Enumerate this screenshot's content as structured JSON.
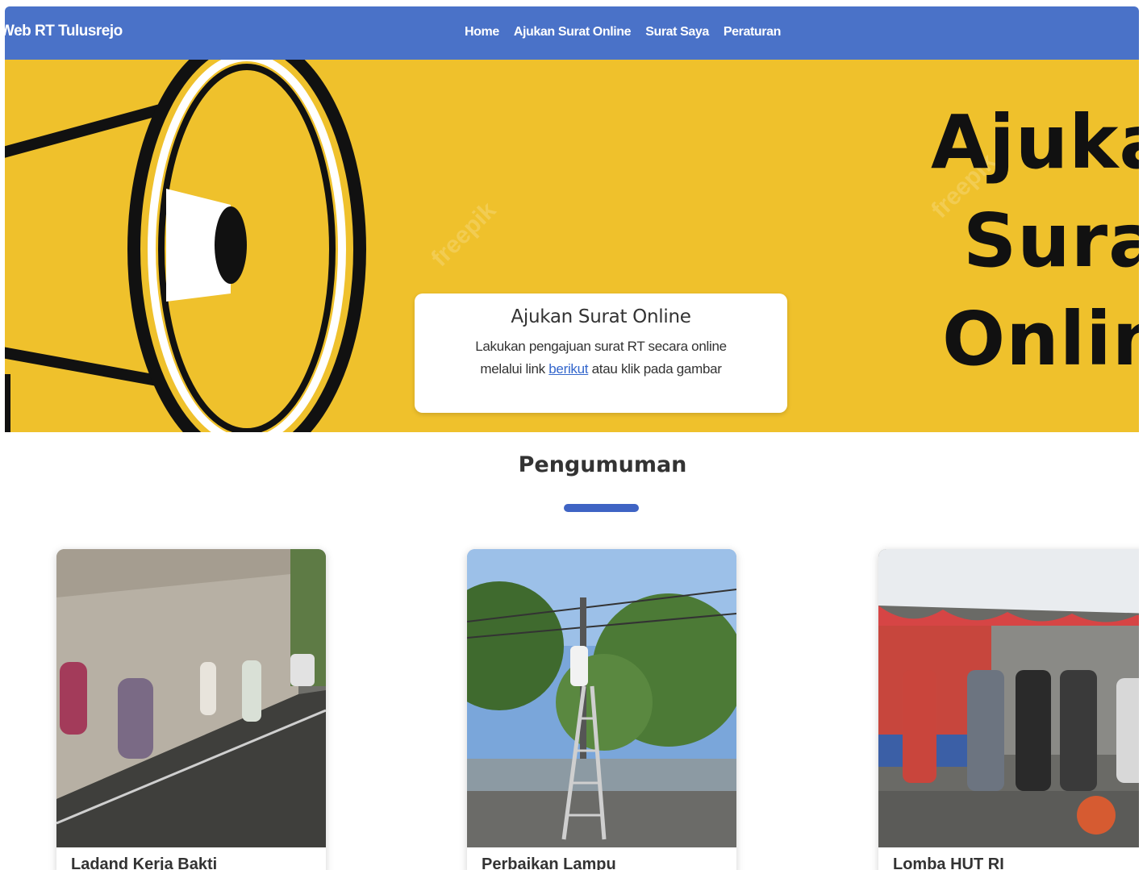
{
  "navbar": {
    "brand": "Web RT Tulusrejo",
    "links": [
      "Home",
      "Ajukan Surat Online",
      "Surat Saya",
      "Peraturan"
    ]
  },
  "hero": {
    "big_text": [
      "Ajuka",
      "Surat",
      "Onlin"
    ],
    "caption": {
      "title": "Ajukan Surat Online",
      "line1": "Lakukan pengajuan surat RT secara online",
      "line2_before": "melalui link ",
      "link": "berikut",
      "line2_after": " atau klik pada gambar"
    }
  },
  "announcements": {
    "title": "Pengumuman",
    "cards": [
      {
        "title": "Ladand Kerja Bakti"
      },
      {
        "title": "Perbaikan Lampu"
      },
      {
        "title": "Lomba HUT RI"
      }
    ]
  },
  "colors": {
    "navbar": "#4a72c8",
    "hero_yellow": "#efc12c",
    "accent_bar": "#3f64c4"
  }
}
